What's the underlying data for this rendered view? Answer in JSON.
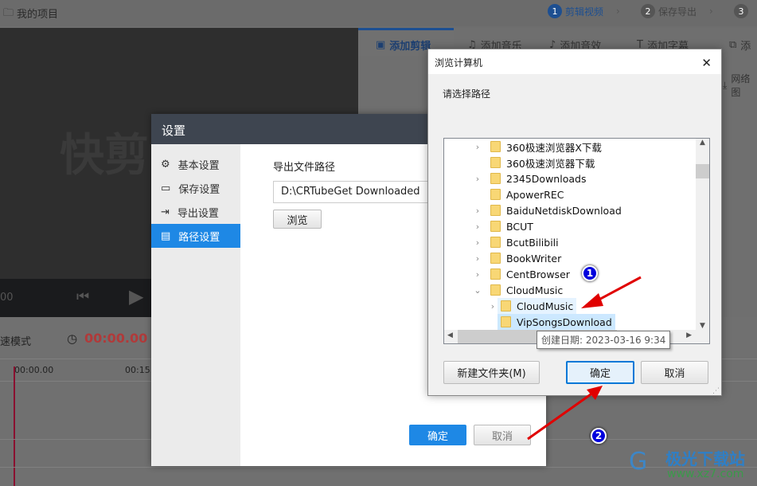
{
  "app": {
    "project_label": "我的项目",
    "steps": [
      {
        "num": "1",
        "label": "剪辑视频",
        "active": true
      },
      {
        "num": "2",
        "label": "保存导出",
        "active": false
      },
      {
        "num": "3",
        "label": "",
        "active": false
      }
    ],
    "tabs": [
      "添加剪辑",
      "添加音乐",
      "添加音效",
      "添加字幕",
      "添"
    ],
    "network_label": "网络图",
    "watermark_text": "快剪",
    "time_left": "00",
    "speed_mode": "速模式",
    "current_time": "00:00.00",
    "ruler": [
      "00:00.00",
      "00:15."
    ]
  },
  "settings": {
    "title": "设置",
    "sidebar": [
      {
        "label": "基本设置",
        "icon": "gear-icon"
      },
      {
        "label": "保存设置",
        "icon": "save-icon"
      },
      {
        "label": "导出设置",
        "icon": "export-icon"
      },
      {
        "label": "路径设置",
        "icon": "folder-icon",
        "active": true
      }
    ],
    "path_label": "导出文件路径",
    "path_value": "D:\\CRTubeGet Downloaded",
    "browse": "浏览",
    "ok": "确定",
    "cancel": "取消"
  },
  "browse_dialog": {
    "title": "浏览计算机",
    "prompt": "请选择路径",
    "tree": [
      {
        "label": "360极速浏览器X下载",
        "expander": ">",
        "level": 0
      },
      {
        "label": "360极速浏览器下载",
        "expander": "",
        "level": 0
      },
      {
        "label": "2345Downloads",
        "expander": ">",
        "level": 0
      },
      {
        "label": "ApowerREC",
        "expander": "",
        "level": 0
      },
      {
        "label": "BaiduNetdiskDownload",
        "expander": ">",
        "level": 0
      },
      {
        "label": "BCUT",
        "expander": ">",
        "level": 0
      },
      {
        "label": "BcutBilibili",
        "expander": ">",
        "level": 0
      },
      {
        "label": "BookWriter",
        "expander": ">",
        "level": 0
      },
      {
        "label": "CentBrowser",
        "expander": ">",
        "level": 0
      },
      {
        "label": "CloudMusic",
        "expander": "v",
        "level": 0
      },
      {
        "label": "CloudMusic",
        "expander": ">",
        "level": 1,
        "state": "hover"
      },
      {
        "label": "VipSongsDownload",
        "expander": "",
        "level": 1,
        "state": "selected"
      }
    ],
    "tooltip": "创建日期: 2023-03-16 9:34",
    "new_folder": "新建文件夹(M)",
    "ok": "确定",
    "cancel": "取消"
  },
  "annotations": [
    "1",
    "2"
  ],
  "watermark": {
    "name": "极光下载站",
    "url": "www.xz7.com"
  },
  "colors": {
    "accent": "#1e88e5",
    "header": "#3e4550",
    "arrow": "#e00000",
    "badge": "#0000dd",
    "time": "#b03a3a"
  }
}
